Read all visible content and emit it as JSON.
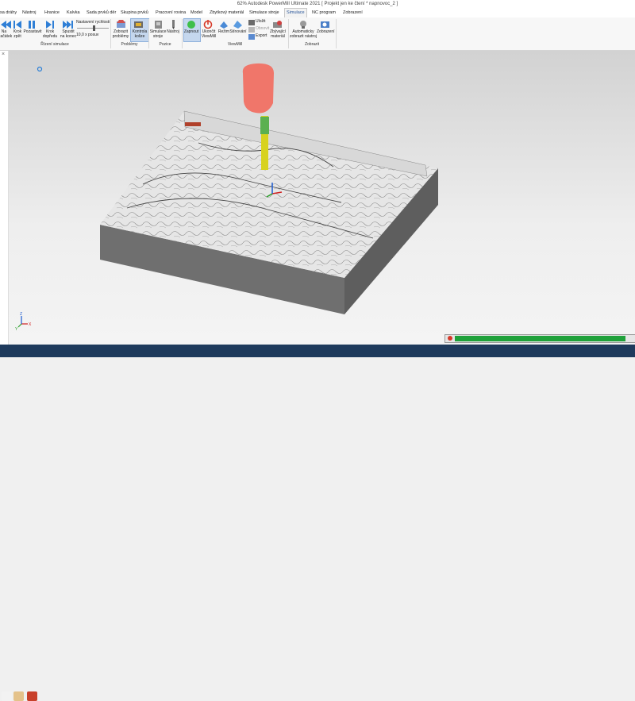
{
  "window": {
    "title": "62% Autodesk PowerMill Ultimate 2021   [ Projekt jen ke čtení * napnovoc_2 ]"
  },
  "tabs": [
    {
      "label": "Dráhy",
      "text": "sa dráhy"
    },
    {
      "label": "Nástroj"
    },
    {
      "label": "Hranice"
    },
    {
      "label": "Kalvka"
    },
    {
      "label": "Sada prvků děr"
    },
    {
      "label": "Skupina prvků"
    },
    {
      "label": "Pracovní rovina"
    },
    {
      "label": "Model"
    },
    {
      "label": "Zbytkový materiál"
    },
    {
      "label": "Simulace stroje"
    },
    {
      "label": "Simulace"
    },
    {
      "label": "NC program"
    },
    {
      "label": "Zobrazení"
    }
  ],
  "active_tab_index": 10,
  "ribbon": {
    "buttons": {
      "na_zacatek": "Na\nzačátek",
      "krok_zpet": "Krok\nzpět",
      "pozastavit": "Pozastavit",
      "krok_dopredu": "Krok\ndopředu",
      "spustit_na_konec": "Spustit\nna konec",
      "nastaveni_rychlosti": "Nastavení rychlosti",
      "posuv_value": "10,0 x posuv",
      "zobrazit_problemy": "Zobrazit\nproblémy",
      "kontrola_kolize": "Kontrola\nkolize",
      "simulace_nastroj": "Simulace\nstroje",
      "nastroj": "Nástroj",
      "zapnout": "Zapnout",
      "ukoncit_viewmill": "Ukončit\nViewMill",
      "rezim": "Režim",
      "stinovani": "Stínování",
      "ulozit": "Uložit",
      "obnovit": "Obnovit",
      "export": "Export",
      "zbyvajici_material": "Zbývající\nmateriál",
      "automaticky_zobrazit_nastroj": "Automaticky\nzobrazit nástroj",
      "zobrazeni": "Zobrazení"
    },
    "groups": {
      "rizeni_simulace": "Řízení simulace",
      "problemy": "Problémy",
      "pozice": "Pozice",
      "viewmill": "ViewMill",
      "zobrazit": "Zobrazit"
    }
  },
  "viewport": {
    "axis_labels": {
      "x": "X",
      "y": "Y",
      "z": "Z"
    },
    "colors": {
      "tool_holder": "#f0766a",
      "tool_shank": "#d8d21e",
      "stock_top": "#e6e6e6",
      "stock_side": "#6f6f6f"
    }
  },
  "progress": {
    "value": 0.95
  },
  "colors": {
    "accent": "#2b579a",
    "status": "#1e3a5c",
    "progress": "#1fa13a"
  }
}
